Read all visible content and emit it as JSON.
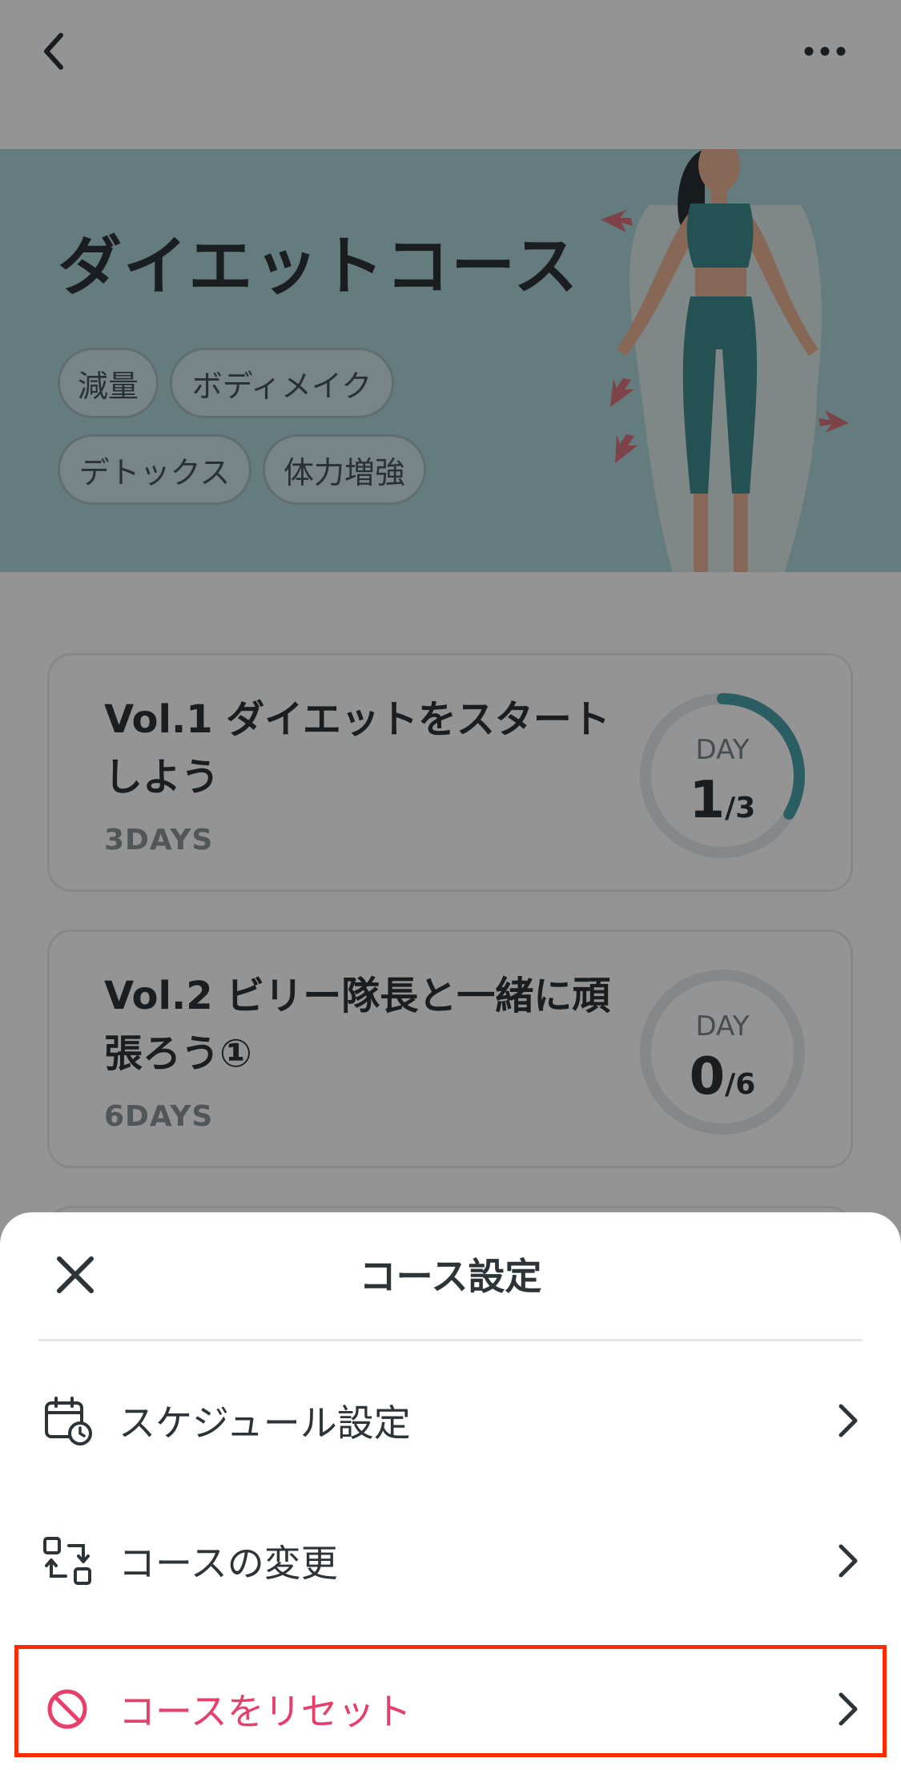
{
  "hero": {
    "title": "ダイエットコース",
    "tags": [
      "減量",
      "ボディメイク",
      "デトックス",
      "体力増強"
    ]
  },
  "courses": [
    {
      "title": "Vol.1 ダイエットをスタートしよう",
      "days": "3DAYS",
      "day_label": "DAY",
      "current": "1",
      "total": "/3",
      "progress": 0.333
    },
    {
      "title": "Vol.2 ビリー隊長と一緒に頑張ろう①",
      "days": "6DAYS",
      "day_label": "DAY",
      "current": "0",
      "total": "/6",
      "progress": 0
    }
  ],
  "sheet": {
    "title": "コース設定",
    "items": [
      {
        "label": "スケジュール設定",
        "icon": "calendar-clock-icon"
      },
      {
        "label": "コースの変更",
        "icon": "swap-icon"
      },
      {
        "label": "コースをリセット",
        "icon": "prohibit-icon"
      }
    ]
  },
  "colors": {
    "accent": "#4aa3aa",
    "danger": "#e83e6a",
    "highlight": "#ff2a00",
    "hero_bg": "#aed6da"
  }
}
